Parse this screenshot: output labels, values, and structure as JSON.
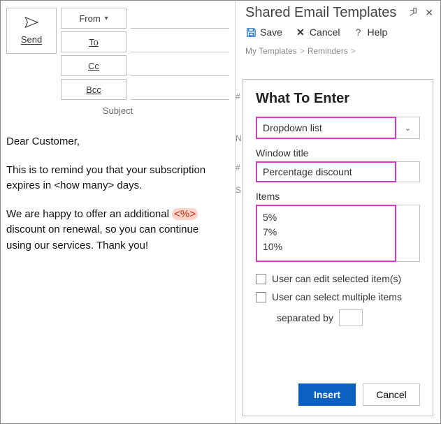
{
  "compose": {
    "send_label": "Send",
    "from_label": "From",
    "to_label": "To",
    "cc_label": "Cc",
    "bcc_label": "Bcc",
    "subject_label": "Subject"
  },
  "email": {
    "greeting": "Dear Customer,",
    "para1_a": "This is to remind you that your subscription expires in ",
    "para1_placeholder": "<how many>",
    "para1_b": " days.",
    "para2_a": "We are happy to offer an additional ",
    "para2_placeholder": "<%>",
    "para2_b": " discount on renewal, so you can continue using our services. Thank you!"
  },
  "panel": {
    "title": "Shared Email Templates",
    "save": "Save",
    "cancel": "Cancel",
    "help": "Help",
    "breadcrumb": {
      "a": "My Templates",
      "b": "Reminders"
    }
  },
  "dialog": {
    "title": "What To Enter",
    "type_value": "Dropdown list",
    "window_title_label": "Window title",
    "window_title_value": "Percentage discount",
    "items_label": "Items",
    "items": [
      "5%",
      "7%",
      "10%"
    ],
    "chk_edit": "User can edit selected item(s)",
    "chk_multi": "User can select multiple items",
    "separated_by": "separated by",
    "insert": "Insert",
    "cancel": "Cancel"
  }
}
